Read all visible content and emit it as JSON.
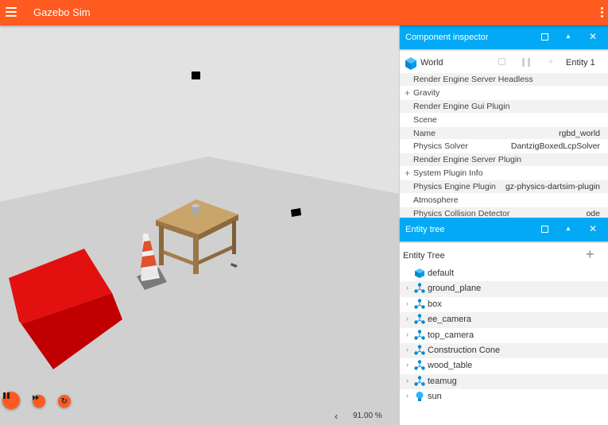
{
  "app": {
    "title": "Gazebo Sim"
  },
  "scene": {
    "rtf": "91.00 %"
  },
  "inspector": {
    "title": "Component inspector",
    "entity_name": "World",
    "entity_id": "Entity 1",
    "components": [
      {
        "key": "Render Engine Server Headless",
        "value": "",
        "expandable": false
      },
      {
        "key": "Gravity",
        "value": "",
        "expandable": true
      },
      {
        "key": "Render Engine Gui Plugin",
        "value": "",
        "expandable": false
      },
      {
        "key": "Scene",
        "value": "",
        "expandable": false
      },
      {
        "key": "Name",
        "value": "rgbd_world",
        "expandable": false
      },
      {
        "key": "Physics Solver",
        "value": "DantzigBoxedLcpSolver",
        "expandable": false
      },
      {
        "key": "Render Engine Server Plugin",
        "value": "",
        "expandable": false
      },
      {
        "key": "System Plugin Info",
        "value": "",
        "expandable": true
      },
      {
        "key": "Physics Engine Plugin",
        "value": "gz-physics-dartsim-plugin",
        "expandable": false
      },
      {
        "key": "Atmosphere",
        "value": "",
        "expandable": false
      },
      {
        "key": "Physics Collision Detector",
        "value": "ode",
        "expandable": false
      }
    ]
  },
  "entity_tree": {
    "header_title": "Entity tree",
    "title": "Entity Tree",
    "items": [
      {
        "label": "default",
        "icon": "world-cube-icon",
        "expandable": false
      },
      {
        "label": "ground_plane",
        "icon": "model-icon",
        "expandable": true
      },
      {
        "label": "box",
        "icon": "model-icon",
        "expandable": true
      },
      {
        "label": "ee_camera",
        "icon": "model-icon",
        "expandable": true
      },
      {
        "label": "top_camera",
        "icon": "model-icon",
        "expandable": true
      },
      {
        "label": "Construction Cone",
        "icon": "model-icon",
        "expandable": true
      },
      {
        "label": "wood_table",
        "icon": "model-icon",
        "expandable": true
      },
      {
        "label": "teamug",
        "icon": "model-icon",
        "expandable": true
      },
      {
        "label": "sun",
        "icon": "light-bulb-icon",
        "expandable": true
      }
    ]
  },
  "colors": {
    "primary": "#ff5a1f",
    "accent": "#03a9f4",
    "box": "#e00000"
  }
}
